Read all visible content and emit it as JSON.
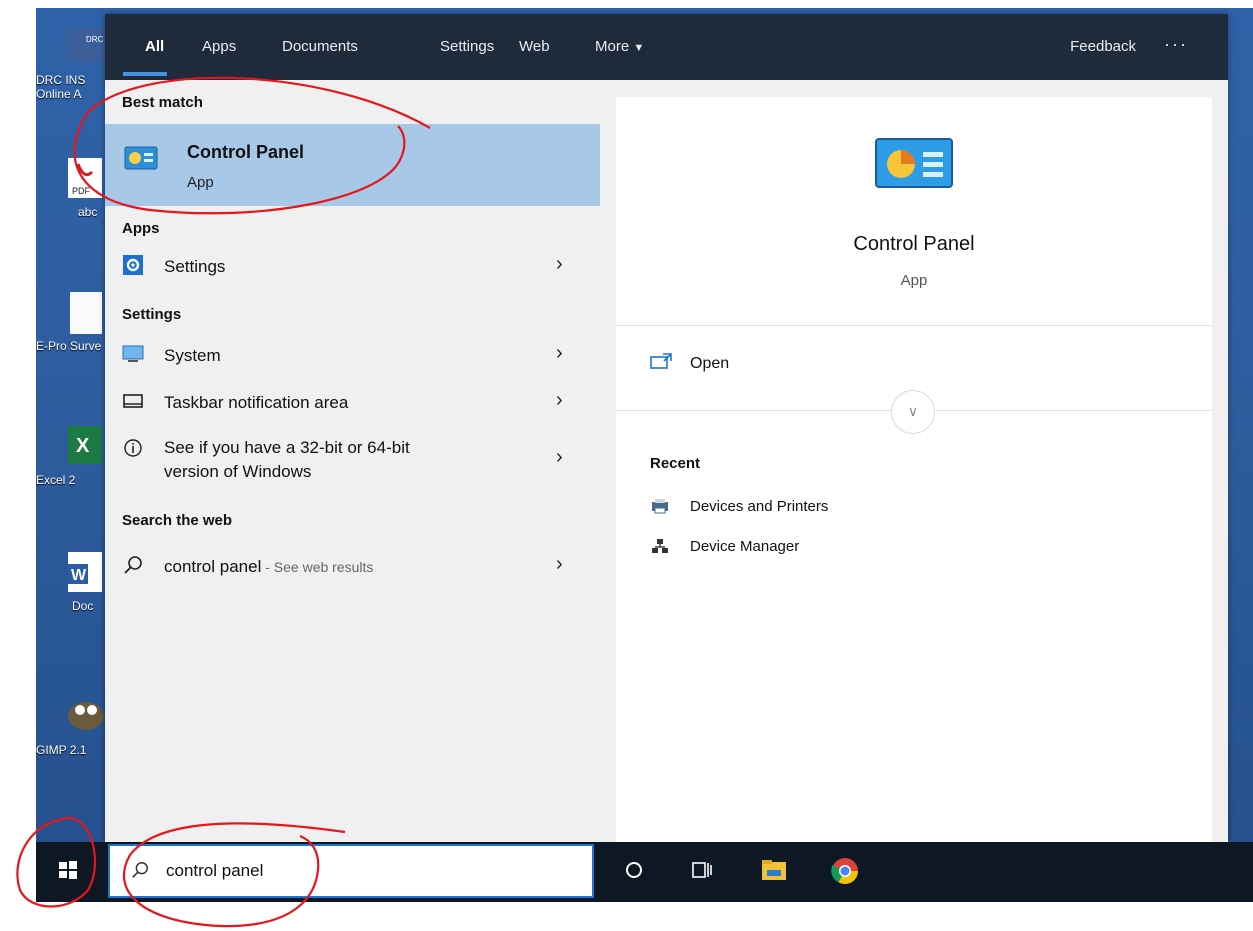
{
  "tabs": [
    "All",
    "Apps",
    "Documents",
    "Settings",
    "Web",
    "More"
  ],
  "topbar": {
    "feedback": "Feedback",
    "more_dots": "···"
  },
  "desktop_icons": [
    {
      "label": "DRC INS Online A",
      "badge": "DRC INSIGHT"
    },
    {
      "label": "abc",
      "badge": "PDF"
    },
    {
      "label": "E-Pro Surve"
    },
    {
      "label": "Excel 2",
      "badge": "X"
    },
    {
      "label": "Doc",
      "badge": "W"
    },
    {
      "label": "GIMP 2.1"
    }
  ],
  "left": {
    "best_match_heading": "Best match",
    "best_match": {
      "title": "Control Panel",
      "subtitle": "App"
    },
    "apps_heading": "Apps",
    "apps_items": [
      {
        "label": "Settings",
        "icon": "gear-icon"
      }
    ],
    "settings_heading": "Settings",
    "settings_items": [
      {
        "label": "System",
        "icon": "monitor-icon"
      },
      {
        "label": "Taskbar notification area",
        "icon": "taskbar-icon"
      },
      {
        "label_line1": "See if you have a 32-bit or 64-bit",
        "label_line2": "version of Windows",
        "icon": "info-icon"
      }
    ],
    "web_heading": "Search the web",
    "web_item": {
      "query": "control panel",
      "suffix": " - See web results",
      "icon": "search-icon"
    }
  },
  "right": {
    "title": "Control Panel",
    "subtitle": "App",
    "open_label": "Open",
    "recent_heading": "Recent",
    "recent_items": [
      {
        "label": "Devices and Printers",
        "icon": "printer-icon"
      },
      {
        "label": "Device Manager",
        "icon": "device-manager-icon"
      }
    ]
  },
  "taskbar": {
    "search_value": "control panel",
    "icons": [
      "windows-start-icon",
      "cortana-icon",
      "task-view-icon",
      "file-explorer-icon",
      "chrome-icon"
    ]
  },
  "colors": {
    "topbar": "#1f2b3a",
    "highlight": "#a8c8e8",
    "accent": "#1e74d0",
    "annotation": "#e8151b"
  }
}
